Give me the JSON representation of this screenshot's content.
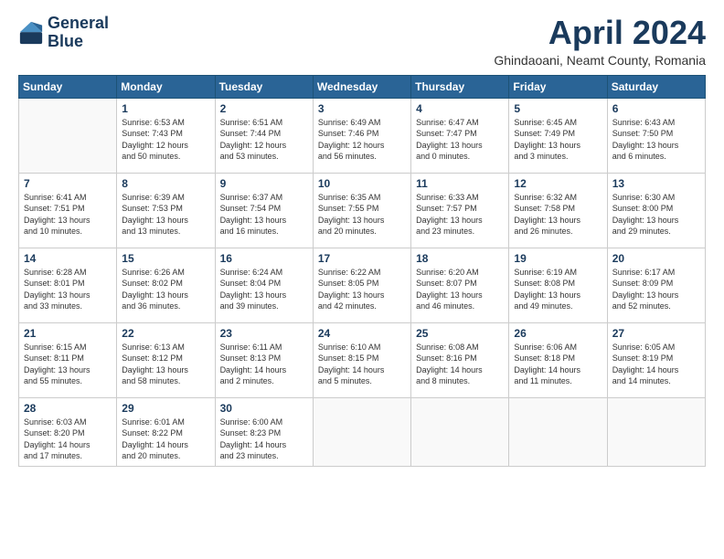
{
  "logo": {
    "line1": "General",
    "line2": "Blue"
  },
  "title": "April 2024",
  "subtitle": "Ghindaoani, Neamt County, Romania",
  "days_header": [
    "Sunday",
    "Monday",
    "Tuesday",
    "Wednesday",
    "Thursday",
    "Friday",
    "Saturday"
  ],
  "weeks": [
    [
      {
        "day": "",
        "info": ""
      },
      {
        "day": "1",
        "info": "Sunrise: 6:53 AM\nSunset: 7:43 PM\nDaylight: 12 hours\nand 50 minutes."
      },
      {
        "day": "2",
        "info": "Sunrise: 6:51 AM\nSunset: 7:44 PM\nDaylight: 12 hours\nand 53 minutes."
      },
      {
        "day": "3",
        "info": "Sunrise: 6:49 AM\nSunset: 7:46 PM\nDaylight: 12 hours\nand 56 minutes."
      },
      {
        "day": "4",
        "info": "Sunrise: 6:47 AM\nSunset: 7:47 PM\nDaylight: 13 hours\nand 0 minutes."
      },
      {
        "day": "5",
        "info": "Sunrise: 6:45 AM\nSunset: 7:49 PM\nDaylight: 13 hours\nand 3 minutes."
      },
      {
        "day": "6",
        "info": "Sunrise: 6:43 AM\nSunset: 7:50 PM\nDaylight: 13 hours\nand 6 minutes."
      }
    ],
    [
      {
        "day": "7",
        "info": "Sunrise: 6:41 AM\nSunset: 7:51 PM\nDaylight: 13 hours\nand 10 minutes."
      },
      {
        "day": "8",
        "info": "Sunrise: 6:39 AM\nSunset: 7:53 PM\nDaylight: 13 hours\nand 13 minutes."
      },
      {
        "day": "9",
        "info": "Sunrise: 6:37 AM\nSunset: 7:54 PM\nDaylight: 13 hours\nand 16 minutes."
      },
      {
        "day": "10",
        "info": "Sunrise: 6:35 AM\nSunset: 7:55 PM\nDaylight: 13 hours\nand 20 minutes."
      },
      {
        "day": "11",
        "info": "Sunrise: 6:33 AM\nSunset: 7:57 PM\nDaylight: 13 hours\nand 23 minutes."
      },
      {
        "day": "12",
        "info": "Sunrise: 6:32 AM\nSunset: 7:58 PM\nDaylight: 13 hours\nand 26 minutes."
      },
      {
        "day": "13",
        "info": "Sunrise: 6:30 AM\nSunset: 8:00 PM\nDaylight: 13 hours\nand 29 minutes."
      }
    ],
    [
      {
        "day": "14",
        "info": "Sunrise: 6:28 AM\nSunset: 8:01 PM\nDaylight: 13 hours\nand 33 minutes."
      },
      {
        "day": "15",
        "info": "Sunrise: 6:26 AM\nSunset: 8:02 PM\nDaylight: 13 hours\nand 36 minutes."
      },
      {
        "day": "16",
        "info": "Sunrise: 6:24 AM\nSunset: 8:04 PM\nDaylight: 13 hours\nand 39 minutes."
      },
      {
        "day": "17",
        "info": "Sunrise: 6:22 AM\nSunset: 8:05 PM\nDaylight: 13 hours\nand 42 minutes."
      },
      {
        "day": "18",
        "info": "Sunrise: 6:20 AM\nSunset: 8:07 PM\nDaylight: 13 hours\nand 46 minutes."
      },
      {
        "day": "19",
        "info": "Sunrise: 6:19 AM\nSunset: 8:08 PM\nDaylight: 13 hours\nand 49 minutes."
      },
      {
        "day": "20",
        "info": "Sunrise: 6:17 AM\nSunset: 8:09 PM\nDaylight: 13 hours\nand 52 minutes."
      }
    ],
    [
      {
        "day": "21",
        "info": "Sunrise: 6:15 AM\nSunset: 8:11 PM\nDaylight: 13 hours\nand 55 minutes."
      },
      {
        "day": "22",
        "info": "Sunrise: 6:13 AM\nSunset: 8:12 PM\nDaylight: 13 hours\nand 58 minutes."
      },
      {
        "day": "23",
        "info": "Sunrise: 6:11 AM\nSunset: 8:13 PM\nDaylight: 14 hours\nand 2 minutes."
      },
      {
        "day": "24",
        "info": "Sunrise: 6:10 AM\nSunset: 8:15 PM\nDaylight: 14 hours\nand 5 minutes."
      },
      {
        "day": "25",
        "info": "Sunrise: 6:08 AM\nSunset: 8:16 PM\nDaylight: 14 hours\nand 8 minutes."
      },
      {
        "day": "26",
        "info": "Sunrise: 6:06 AM\nSunset: 8:18 PM\nDaylight: 14 hours\nand 11 minutes."
      },
      {
        "day": "27",
        "info": "Sunrise: 6:05 AM\nSunset: 8:19 PM\nDaylight: 14 hours\nand 14 minutes."
      }
    ],
    [
      {
        "day": "28",
        "info": "Sunrise: 6:03 AM\nSunset: 8:20 PM\nDaylight: 14 hours\nand 17 minutes."
      },
      {
        "day": "29",
        "info": "Sunrise: 6:01 AM\nSunset: 8:22 PM\nDaylight: 14 hours\nand 20 minutes."
      },
      {
        "day": "30",
        "info": "Sunrise: 6:00 AM\nSunset: 8:23 PM\nDaylight: 14 hours\nand 23 minutes."
      },
      {
        "day": "",
        "info": ""
      },
      {
        "day": "",
        "info": ""
      },
      {
        "day": "",
        "info": ""
      },
      {
        "day": "",
        "info": ""
      }
    ]
  ]
}
